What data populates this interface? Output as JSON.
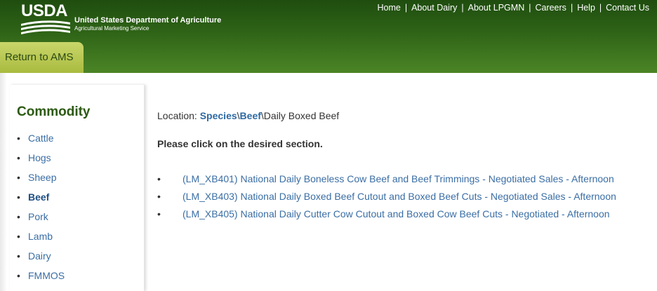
{
  "header": {
    "logo_text": "USDA",
    "agency_name": "United States Department of Agriculture",
    "agency_sub": "Agricultural Marketing Service",
    "nav": [
      {
        "label": "Home"
      },
      {
        "label": "About Dairy"
      },
      {
        "label": "About LPGMN"
      },
      {
        "label": "Careers"
      },
      {
        "label": "Help"
      },
      {
        "label": "Contact Us"
      }
    ],
    "nav_separator": "|",
    "return_label": "Return to AMS"
  },
  "sidebar": {
    "title": "Commodity",
    "items": [
      {
        "label": "Cattle"
      },
      {
        "label": "Hogs"
      },
      {
        "label": "Sheep"
      },
      {
        "label": "Beef",
        "active": true
      },
      {
        "label": "Pork"
      },
      {
        "label": "Lamb"
      },
      {
        "label": "Dairy"
      },
      {
        "label": "FMMOS"
      }
    ]
  },
  "main": {
    "location_prefix": "Location:",
    "breadcrumb": {
      "species": "Species",
      "sep1": "\\",
      "beef": "Beef",
      "sep2": "\\",
      "current": "Daily Boxed Beef"
    },
    "instruction": "Please click on the desired section.",
    "reports": [
      {
        "label": "(LM_XB401) National Daily Boneless Cow Beef and Beef Trimmings - Negotiated Sales - Afternoon"
      },
      {
        "label": "(LM_XB403) National Daily Boxed Beef Cutout and Boxed Beef Cuts - Negotiated Sales - Afternoon"
      },
      {
        "label": "(LM_XB405) National Daily Cutter Cow Cutout and Boxed Cow Beef Cuts - Negotiated - Afternoon"
      }
    ]
  },
  "colors": {
    "header_dark": "#1f4d0f",
    "header_light": "#4b8526",
    "tab": "#b4c44e",
    "link": "#3a6ea5",
    "title_green": "#2c5a12"
  }
}
